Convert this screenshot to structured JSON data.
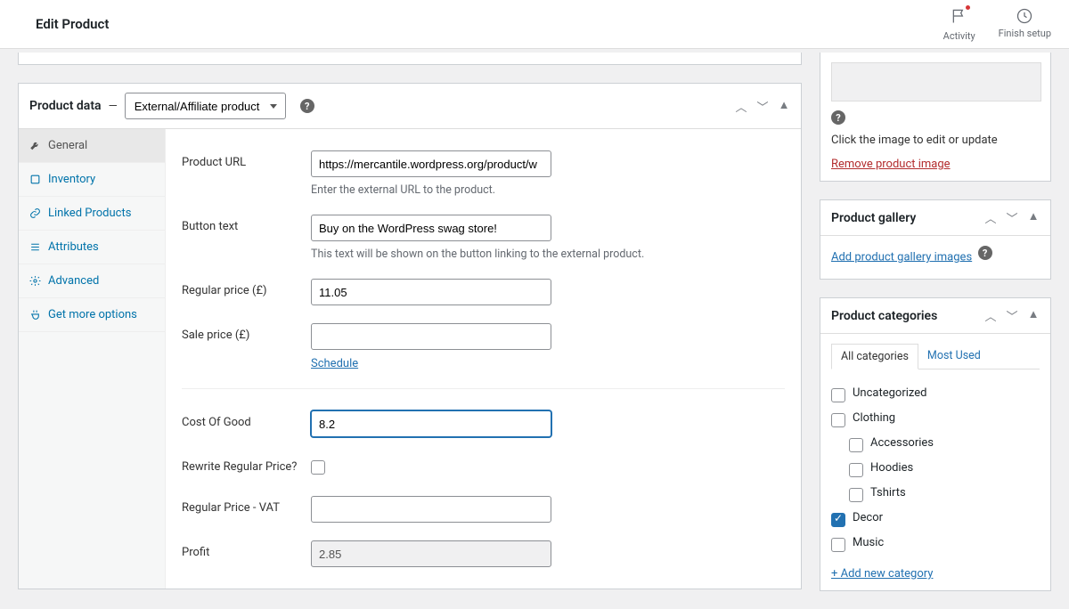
{
  "header": {
    "title": "Edit Product",
    "activity": "Activity",
    "finish": "Finish setup"
  },
  "product_data": {
    "title": "Product data",
    "type_selected": "External/Affiliate product",
    "tabs": {
      "general": "General",
      "inventory": "Inventory",
      "linked": "Linked Products",
      "attributes": "Attributes",
      "advanced": "Advanced",
      "more": "Get more options"
    },
    "fields": {
      "product_url": {
        "label": "Product URL",
        "value": "https://mercantile.wordpress.org/product/w",
        "help": "Enter the external URL to the product."
      },
      "button_text": {
        "label": "Button text",
        "value": "Buy on the WordPress swag store!",
        "help": "This text will be shown on the button linking to the external product."
      },
      "regular_price": {
        "label": "Regular price (£)",
        "value": "11.05"
      },
      "sale_price": {
        "label": "Sale price (£)",
        "value": "",
        "schedule": "Schedule"
      },
      "cog": {
        "label": "Cost Of Good",
        "value": "8.2"
      },
      "rewrite": {
        "label": "Rewrite Regular Price?"
      },
      "regular_vat": {
        "label": "Regular Price - VAT",
        "value": ""
      },
      "profit": {
        "label": "Profit",
        "value": "2.85"
      }
    }
  },
  "image_box": {
    "edit_text": "Click the image to edit or update",
    "remove": "Remove product image"
  },
  "gallery": {
    "title": "Product gallery",
    "add": "Add product gallery images"
  },
  "categories": {
    "title": "Product categories",
    "tab_all": "All categories",
    "tab_used": "Most Used",
    "items": [
      {
        "label": "Uncategorized",
        "checked": false,
        "indent": false
      },
      {
        "label": "Clothing",
        "checked": false,
        "indent": false
      },
      {
        "label": "Accessories",
        "checked": false,
        "indent": true
      },
      {
        "label": "Hoodies",
        "checked": false,
        "indent": true
      },
      {
        "label": "Tshirts",
        "checked": false,
        "indent": true
      },
      {
        "label": "Decor",
        "checked": true,
        "indent": false
      },
      {
        "label": "Music",
        "checked": false,
        "indent": false
      }
    ],
    "add_new": "+ Add new category"
  }
}
